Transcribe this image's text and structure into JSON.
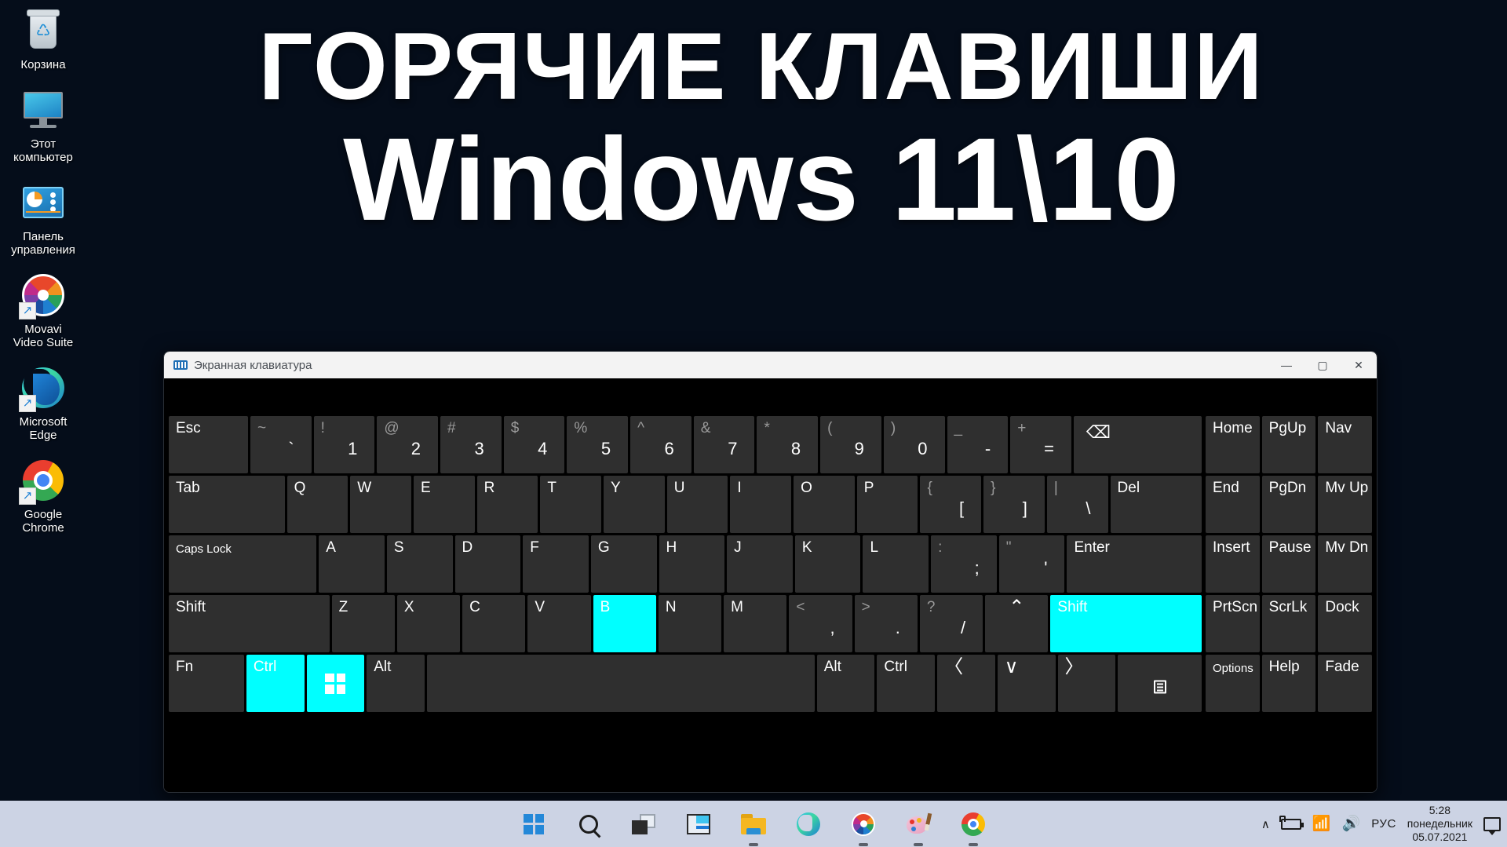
{
  "desktop": {
    "icons": [
      {
        "name": "recycle-bin",
        "label": "Корзина"
      },
      {
        "name": "this-pc",
        "label": "Этот\nкомпьютер"
      },
      {
        "name": "control-panel",
        "label": "Панель\nуправления"
      },
      {
        "name": "movavi-video-suite",
        "label": "Movavi\nVideo Suite"
      },
      {
        "name": "microsoft-edge",
        "label": "Microsoft\nEdge"
      },
      {
        "name": "google-chrome",
        "label": "Google\nChrome"
      }
    ]
  },
  "banner": {
    "line1": "ГОРЯЧИЕ КЛАВИШИ",
    "line2": "Windows 11\\10"
  },
  "osk": {
    "title": "Экранная клавиатура",
    "window_buttons": {
      "minimize": "—",
      "maximize": "▢",
      "close": "✕"
    },
    "highlight_color": "#00ffff",
    "key_bg": "#2f2f2f",
    "rows": {
      "row1": [
        {
          "label": "Esc",
          "type": "label",
          "w": "w-esc"
        },
        {
          "shift": "~",
          "base": "`",
          "type": "dual"
        },
        {
          "shift": "!",
          "base": "1",
          "type": "dual"
        },
        {
          "shift": "@",
          "base": "2",
          "type": "dual"
        },
        {
          "shift": "#",
          "base": "3",
          "type": "dual"
        },
        {
          "shift": "$",
          "base": "4",
          "type": "dual"
        },
        {
          "shift": "%",
          "base": "5",
          "type": "dual"
        },
        {
          "shift": "^",
          "base": "6",
          "type": "dual"
        },
        {
          "shift": "&",
          "base": "7",
          "type": "dual"
        },
        {
          "shift": "*",
          "base": "8",
          "type": "dual"
        },
        {
          "shift": "(",
          "base": "9",
          "type": "dual"
        },
        {
          "shift": ")",
          "base": "0",
          "type": "dual"
        },
        {
          "shift": "_",
          "base": "-",
          "type": "dual"
        },
        {
          "shift": "+",
          "base": "=",
          "type": "dual"
        },
        {
          "label": "⌫",
          "type": "backspace",
          "w": "w-bksp"
        }
      ],
      "row2": [
        {
          "label": "Tab",
          "type": "label",
          "w": "w-tab"
        },
        {
          "label": "Q",
          "type": "label"
        },
        {
          "label": "W",
          "type": "label"
        },
        {
          "label": "E",
          "type": "label"
        },
        {
          "label": "R",
          "type": "label"
        },
        {
          "label": "T",
          "type": "label"
        },
        {
          "label": "Y",
          "type": "label"
        },
        {
          "label": "U",
          "type": "label"
        },
        {
          "label": "I",
          "type": "label"
        },
        {
          "label": "O",
          "type": "label"
        },
        {
          "label": "P",
          "type": "label"
        },
        {
          "shift": "{",
          "base": "[",
          "type": "dual"
        },
        {
          "shift": "}",
          "base": "]",
          "type": "dual"
        },
        {
          "shift": "|",
          "base": "\\",
          "type": "dual"
        },
        {
          "label": "Del",
          "type": "label",
          "w": "w-del"
        }
      ],
      "row3": [
        {
          "label": "Caps Lock",
          "type": "label",
          "w": "w-caps"
        },
        {
          "label": "A",
          "type": "label"
        },
        {
          "label": "S",
          "type": "label"
        },
        {
          "label": "D",
          "type": "label"
        },
        {
          "label": "F",
          "type": "label"
        },
        {
          "label": "G",
          "type": "label"
        },
        {
          "label": "H",
          "type": "label"
        },
        {
          "label": "J",
          "type": "label"
        },
        {
          "label": "K",
          "type": "label"
        },
        {
          "label": "L",
          "type": "label"
        },
        {
          "shift": ":",
          "base": ";",
          "type": "dual"
        },
        {
          "shift": "\"",
          "base": "'",
          "type": "dual"
        },
        {
          "label": "Enter",
          "type": "label",
          "w": "w-enter"
        }
      ],
      "row4": [
        {
          "label": "Shift",
          "type": "label",
          "w": "w-shiftL"
        },
        {
          "label": "Z",
          "type": "label"
        },
        {
          "label": "X",
          "type": "label"
        },
        {
          "label": "C",
          "type": "label"
        },
        {
          "label": "V",
          "type": "label"
        },
        {
          "label": "B",
          "type": "label",
          "highlight": true
        },
        {
          "label": "N",
          "type": "label"
        },
        {
          "label": "M",
          "type": "label"
        },
        {
          "shift": "<",
          "base": ",",
          "type": "dual"
        },
        {
          "shift": ">",
          "base": ".",
          "type": "dual"
        },
        {
          "shift": "?",
          "base": "/",
          "type": "dual"
        },
        {
          "label": "⌃",
          "type": "arrow-up",
          "w": "w-up"
        },
        {
          "label": "Shift",
          "type": "label",
          "w": "w-shiftR",
          "highlight": true
        }
      ],
      "row5": [
        {
          "label": "Fn",
          "type": "label",
          "w": "w-fn"
        },
        {
          "label": "Ctrl",
          "type": "label",
          "w": "w-mod",
          "highlight": true
        },
        {
          "label": "",
          "type": "win",
          "w": "w-mod",
          "highlight": true
        },
        {
          "label": "Alt",
          "type": "label",
          "w": "w-mod"
        },
        {
          "label": "",
          "type": "space",
          "w": "w-space"
        },
        {
          "label": "Alt",
          "type": "label",
          "w": "w-mod"
        },
        {
          "label": "Ctrl",
          "type": "label",
          "w": "w-mod"
        },
        {
          "label": "〈",
          "type": "arrow",
          "w": "w-mod"
        },
        {
          "label": "∨",
          "type": "arrow",
          "w": "w-mod"
        },
        {
          "label": "〉",
          "type": "arrow",
          "w": "w-mod"
        },
        {
          "label": "",
          "type": "menu",
          "w": "w-menu"
        }
      ],
      "nav": [
        [
          "Home",
          "PgUp",
          "Nav"
        ],
        [
          "End",
          "PgDn",
          "Mv Up"
        ],
        [
          "Insert",
          "Pause",
          "Mv Dn"
        ],
        [
          "PrtScn",
          "ScrLk",
          "Dock"
        ],
        [
          "Options",
          "Help",
          "Fade"
        ]
      ]
    }
  },
  "taskbar": {
    "apps": [
      {
        "name": "start-button",
        "label": "Пуск"
      },
      {
        "name": "search-button",
        "label": "Поиск"
      },
      {
        "name": "task-view-button",
        "label": "Представление задач"
      },
      {
        "name": "widgets-button",
        "label": "Виджеты"
      },
      {
        "name": "file-explorer-button",
        "label": "Проводник"
      },
      {
        "name": "edge-button",
        "label": "Microsoft Edge"
      },
      {
        "name": "movavi-button",
        "label": "Movavi Video Suite"
      },
      {
        "name": "paint-button",
        "label": "Paint"
      },
      {
        "name": "chrome-button",
        "label": "Google Chrome"
      }
    ],
    "tray": {
      "overflow": "∧",
      "language": "РУС",
      "time": "5:28",
      "day": "понедельник",
      "date": "05.07.2021"
    }
  }
}
